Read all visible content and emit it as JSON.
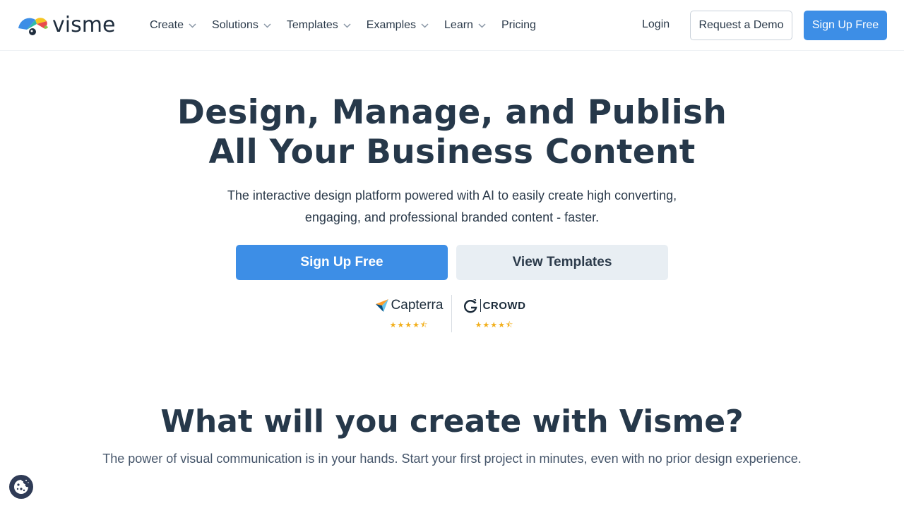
{
  "brand": {
    "name": "visme",
    "accent": "#3d8ee6"
  },
  "nav": {
    "items": [
      {
        "label": "Create",
        "has_dropdown": true
      },
      {
        "label": "Solutions",
        "has_dropdown": true
      },
      {
        "label": "Templates",
        "has_dropdown": true
      },
      {
        "label": "Examples",
        "has_dropdown": true
      },
      {
        "label": "Learn",
        "has_dropdown": true
      },
      {
        "label": "Pricing",
        "has_dropdown": false
      }
    ],
    "login": "Login",
    "demo": "Request a Demo",
    "signup": "Sign Up Free"
  },
  "hero": {
    "title_line1": "Design, Manage, and Publish",
    "title_line2": "All Your Business Content",
    "subtitle_line1": "The interactive design platform powered with AI to easily create high converting,",
    "subtitle_line2": "engaging, and professional branded content - faster.",
    "primary_cta": "Sign Up Free",
    "secondary_cta": "View Templates"
  },
  "ratings": {
    "capterra": {
      "name": "Capterra",
      "stars": "★★★★⯪"
    },
    "g2": {
      "name": "CROWD",
      "prefix": "G2",
      "stars": "★★★★⯪"
    }
  },
  "section": {
    "title": "What will you create with Visme?",
    "subtitle": "The power of visual communication is in your hands. Start your first project in minutes, even with no prior design experience."
  },
  "cookie": {
    "icon": "cookie-icon"
  }
}
